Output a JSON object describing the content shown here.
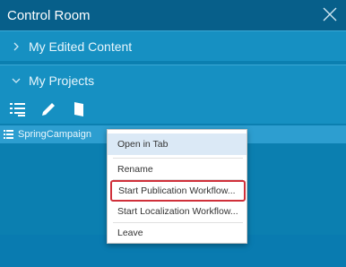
{
  "window": {
    "title": "Control Room",
    "close_icon": "close-icon"
  },
  "sections": [
    {
      "label": "My Edited Content",
      "expanded": false
    },
    {
      "label": "My Projects",
      "expanded": true
    }
  ],
  "toolbar": {
    "icons": [
      "list-icon",
      "pencil-icon",
      "door-icon"
    ]
  },
  "project_row": {
    "label": "SpringCampaign",
    "icon": "list-icon"
  },
  "context_menu": {
    "items": [
      {
        "label": "Open in Tab"
      },
      {
        "label": "Rename"
      },
      {
        "label": "Start Publication Workflow..."
      },
      {
        "label": "Start Localization Workflow..."
      },
      {
        "label": "Leave"
      }
    ]
  },
  "colors": {
    "panel_bg": "#0b7fb0",
    "titlebar_bg": "#075f8a",
    "section_bg": "#1690c2",
    "highlight_border": "#d0303a",
    "menu_hover": "#dbe9f6"
  }
}
